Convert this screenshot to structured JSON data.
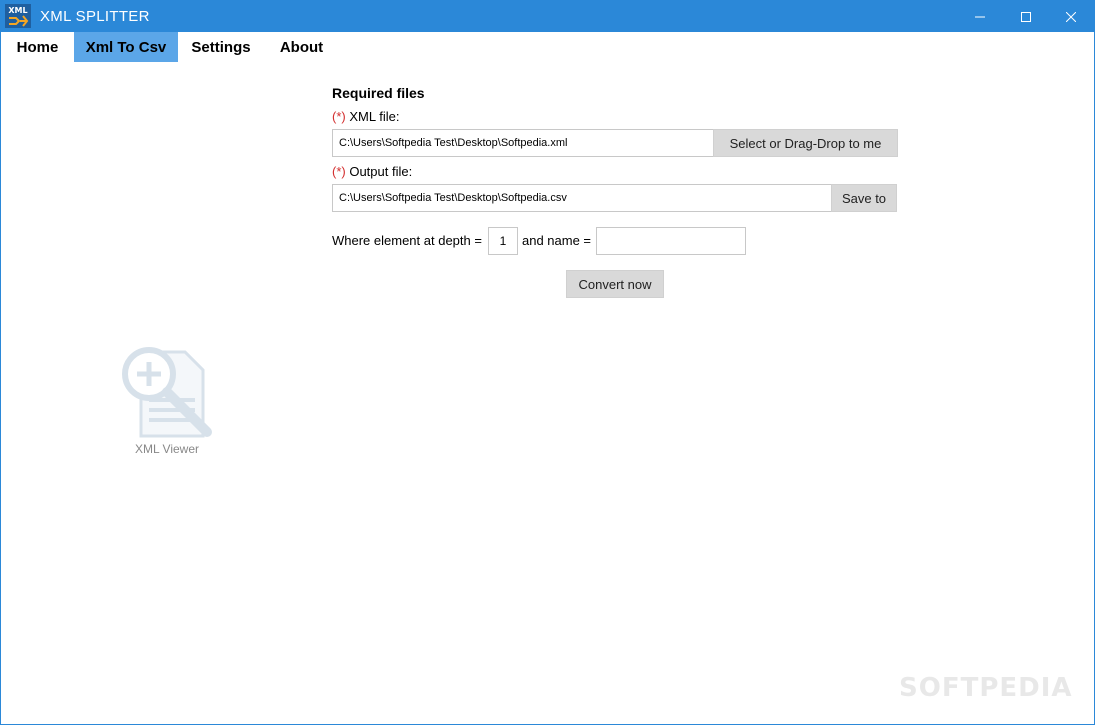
{
  "window": {
    "title": "XML SPLITTER",
    "app_icon_text": "XML"
  },
  "menu": {
    "tabs": [
      {
        "label": "Home"
      },
      {
        "label": "Xml To Csv"
      },
      {
        "label": "Settings"
      },
      {
        "label": "About"
      }
    ],
    "active": "Xml To Csv"
  },
  "form": {
    "section_title": "Required files",
    "required_marker": "(*)",
    "xml_label": "XML file:",
    "xml_value": "C:\\Users\\Softpedia Test\\Desktop\\Softpedia.xml",
    "xml_button": "Select or Drag-Drop to me",
    "output_label": "Output file:",
    "output_value": "C:\\Users\\Softpedia Test\\Desktop\\Softpedia.csv",
    "output_button": "Save to",
    "depth_label": "Where element at depth =",
    "depth_value": "1",
    "name_label": "and name =",
    "name_value": "",
    "convert_button": "Convert now"
  },
  "sidebar": {
    "viewer_label": "XML Viewer"
  },
  "watermark": "SOFTPEDIA",
  "colors": {
    "titlebar": "#2b88d8",
    "active_tab": "#5ba6e8",
    "required": "#d32f2f",
    "button": "#d9d9d9"
  }
}
